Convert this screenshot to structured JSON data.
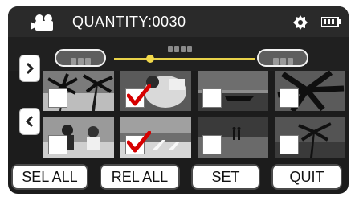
{
  "header": {
    "quantity_text": "QUANTITY:0030"
  },
  "buttons": {
    "sel_all": "SEL ALL",
    "rel_all": "REL ALL",
    "set": "SET",
    "quit": "QUIT"
  },
  "thumbnails": [
    {
      "row": 1,
      "col": 1,
      "scene": "palm trees",
      "checked": false
    },
    {
      "row": 1,
      "col": 2,
      "scene": "person reading",
      "checked": true
    },
    {
      "row": 1,
      "col": 3,
      "scene": "boat on water",
      "checked": false
    },
    {
      "row": 1,
      "col": 4,
      "scene": "palm leaves",
      "checked": false
    },
    {
      "row": 2,
      "col": 1,
      "scene": "people on beach",
      "checked": false
    },
    {
      "row": 2,
      "col": 2,
      "scene": "beach chairs",
      "checked": true
    },
    {
      "row": 2,
      "col": 3,
      "scene": "couple at sunset",
      "checked": false
    },
    {
      "row": 2,
      "col": 4,
      "scene": "palm at dusk",
      "checked": false
    }
  ],
  "colors": {
    "accent_check": "#d60000",
    "slider": "#e8d24a"
  }
}
